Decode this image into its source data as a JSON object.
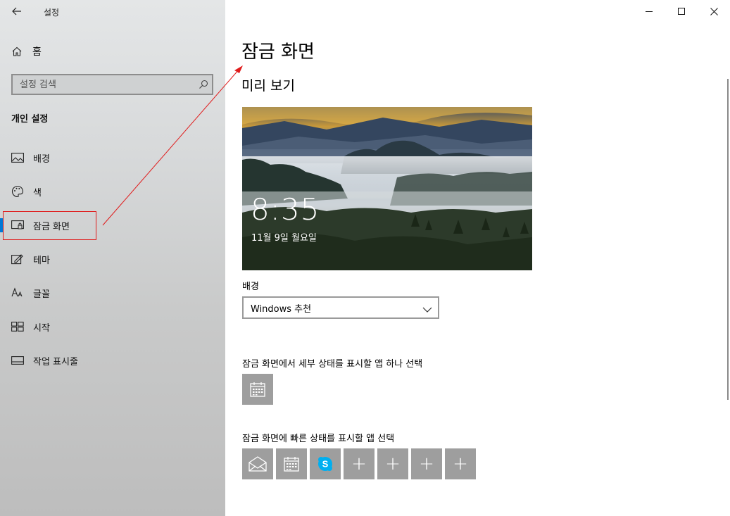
{
  "window": {
    "app_title": "설정",
    "controls": {
      "minimize": "—",
      "maximize": "☐",
      "close": "✕"
    }
  },
  "sidebar": {
    "home_label": "홈",
    "search_placeholder": "설정 검색",
    "section_title": "개인 설정",
    "items": [
      {
        "label": "배경",
        "icon": "picture-icon"
      },
      {
        "label": "색",
        "icon": "palette-icon"
      },
      {
        "label": "잠금 화면",
        "icon": "lock-screen-icon",
        "selected": true
      },
      {
        "label": "테마",
        "icon": "theme-brush-icon"
      },
      {
        "label": "글꼴",
        "icon": "font-icon"
      },
      {
        "label": "시작",
        "icon": "start-grid-icon"
      },
      {
        "label": "작업 표시줄",
        "icon": "taskbar-icon"
      }
    ]
  },
  "main": {
    "title": "잠금 화면",
    "preview_heading": "미리 보기",
    "preview": {
      "time": "8:35",
      "date": "11월 9일 월요일"
    },
    "background_label": "배경",
    "background_value": "Windows 추천",
    "detail_status_label": "잠금 화면에서 세부 상태를 표시할 앱 하나 선택",
    "detail_status_app": "calendar-icon",
    "quick_status_label": "잠금 화면에 빠른 상태를 표시할 앱 선택",
    "quick_status_apps": [
      "mail-icon",
      "calendar-icon",
      "skype-icon",
      "plus-icon",
      "plus-icon",
      "plus-icon",
      "plus-icon"
    ],
    "plus_glyph": "+"
  },
  "colors": {
    "accent": "#0078d7",
    "annotation": "#e01b1b",
    "tile": "#9e9e9e"
  }
}
